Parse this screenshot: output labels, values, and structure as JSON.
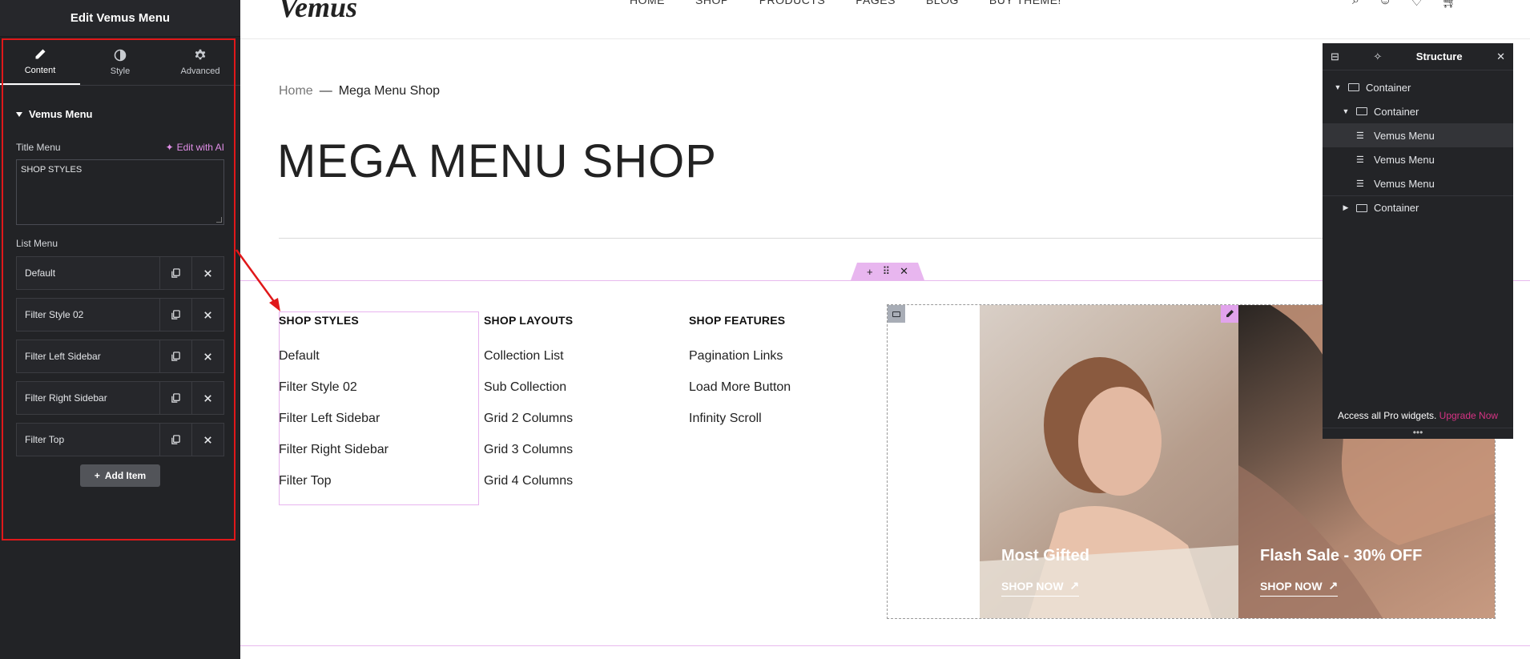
{
  "editor": {
    "title": "Edit Vemus Menu",
    "tabs": [
      {
        "label": "Content",
        "icon": "pencil-icon"
      },
      {
        "label": "Style",
        "icon": "contrast-icon"
      },
      {
        "label": "Advanced",
        "icon": "gear-icon"
      }
    ],
    "section_title": "Vemus Menu",
    "title_menu_label": "Title Menu",
    "edit_ai_label": "Edit with AI",
    "title_menu_value": "SHOP STYLES",
    "list_menu_label": "List Menu",
    "items": [
      "Default",
      "Filter Style 02",
      "Filter Left Sidebar",
      "Filter Right Sidebar",
      "Filter Top"
    ],
    "add_item_label": "Add Item"
  },
  "preview": {
    "logo": "Vemus",
    "nav": [
      "HOME",
      "SHOP",
      "PRODUCTS",
      "PAGES",
      "BLOG",
      "BUY THEME!"
    ],
    "breadcrumb": {
      "home": "Home",
      "sep": "—",
      "current": "Mega Menu Shop"
    },
    "page_title": "MEGA MENU SHOP",
    "columns": [
      {
        "title": "SHOP STYLES",
        "links": [
          "Default",
          "Filter Style 02",
          "Filter Left Sidebar",
          "Filter Right Sidebar",
          "Filter Top"
        ]
      },
      {
        "title": "SHOP LAYOUTS",
        "links": [
          "Collection List",
          "Sub Collection",
          "Grid 2 Columns",
          "Grid 3 Columns",
          "Grid 4 Columns"
        ]
      },
      {
        "title": "SHOP FEATURES",
        "links": [
          "Pagination Links",
          "Load More Button",
          "Infinity Scroll"
        ]
      }
    ],
    "cards": [
      {
        "title": "Most Gifted",
        "cta": "SHOP NOW"
      },
      {
        "title": "Flash Sale - 30% OFF",
        "cta": "SHOP NOW"
      }
    ]
  },
  "structure": {
    "title": "Structure",
    "rows": [
      {
        "label": "Container"
      },
      {
        "label": "Container"
      },
      {
        "label": "Vemus Menu"
      },
      {
        "label": "Vemus Menu"
      },
      {
        "label": "Vemus Menu"
      },
      {
        "label": "Container"
      }
    ],
    "footer_text": "Access all Pro widgets.",
    "footer_link": "Upgrade Now",
    "dots": "•••"
  },
  "colors": {
    "highlight": "#e0181a",
    "accent_pink": "#e8b6ef",
    "panel_bg": "#222326"
  }
}
